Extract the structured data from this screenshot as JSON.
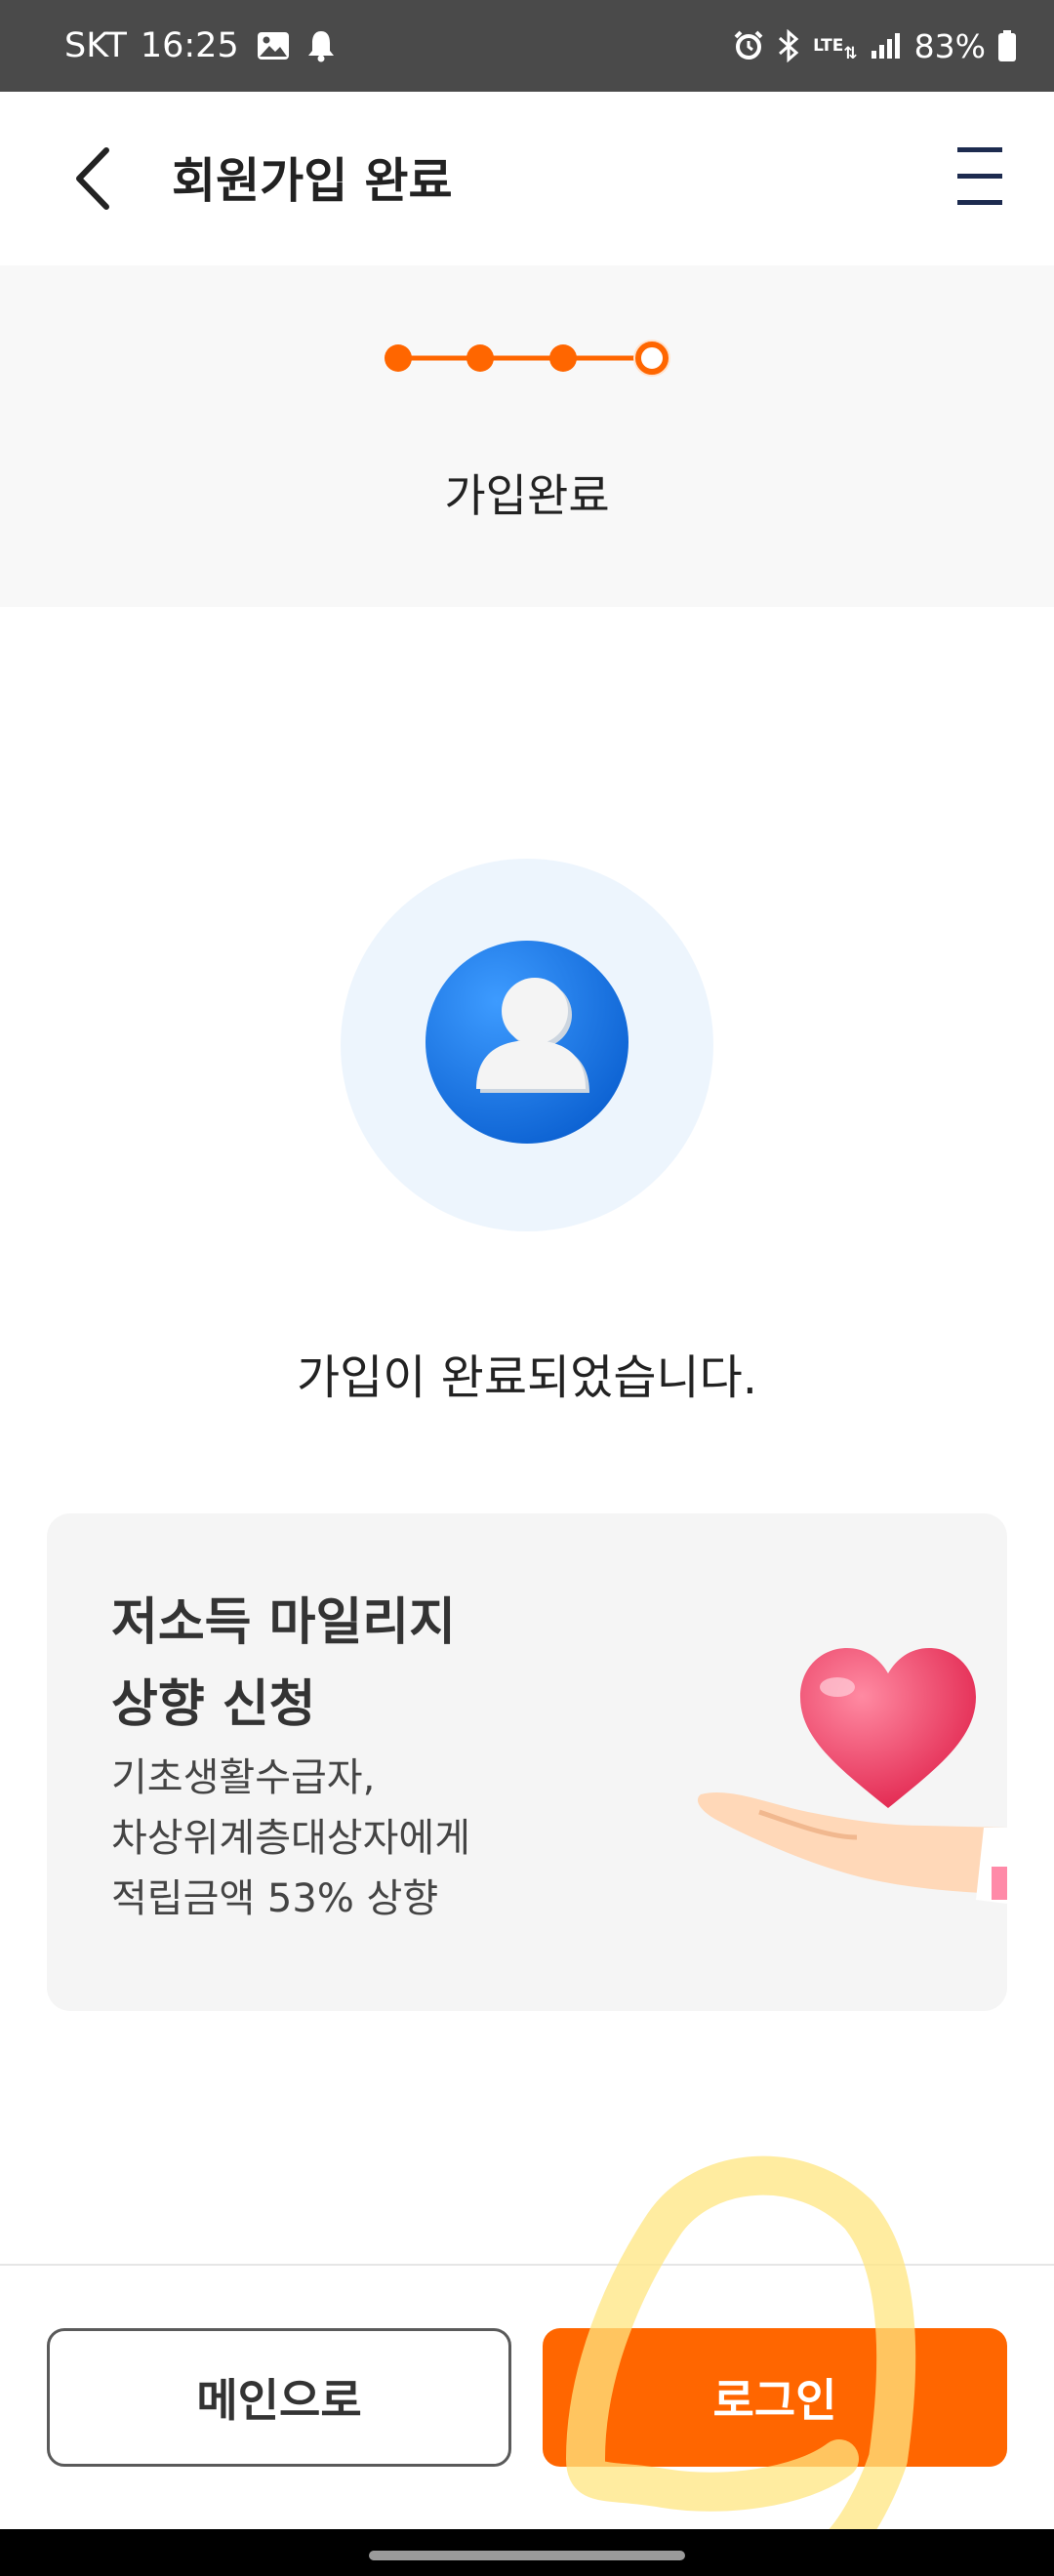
{
  "status_bar": {
    "carrier": "SKT",
    "time": "16:25",
    "network": "LTE",
    "battery": "83%",
    "icons": [
      "gallery-icon",
      "notification-bell-icon",
      "alarm-icon",
      "bluetooth-icon",
      "lte-icon",
      "signal-icon",
      "battery-icon"
    ]
  },
  "header": {
    "title": "회원가입 완료",
    "back_icon": "chevron-left-icon",
    "menu_icon": "hamburger-menu-icon"
  },
  "steps": {
    "total": 4,
    "current": 4,
    "label": "가입완료",
    "accent_color": "#ff6600"
  },
  "main": {
    "avatar_icon": "user-avatar-icon",
    "message": "가입이 완료되었습니다."
  },
  "promo": {
    "title_line1": "저소득 마일리지",
    "title_line2": "상향 신청",
    "desc_line1": "기초생활수급자,",
    "desc_line2": "차상위계층대상자에게",
    "desc_line3": "적립금액 53% 상향",
    "illustration": "heart-in-hand-icon"
  },
  "actions": {
    "main_label": "메인으로",
    "login_label": "로그인"
  },
  "colors": {
    "accent": "#ff6600",
    "avatar_blue": "#1a7fe8",
    "highlight": "#ffe680"
  }
}
